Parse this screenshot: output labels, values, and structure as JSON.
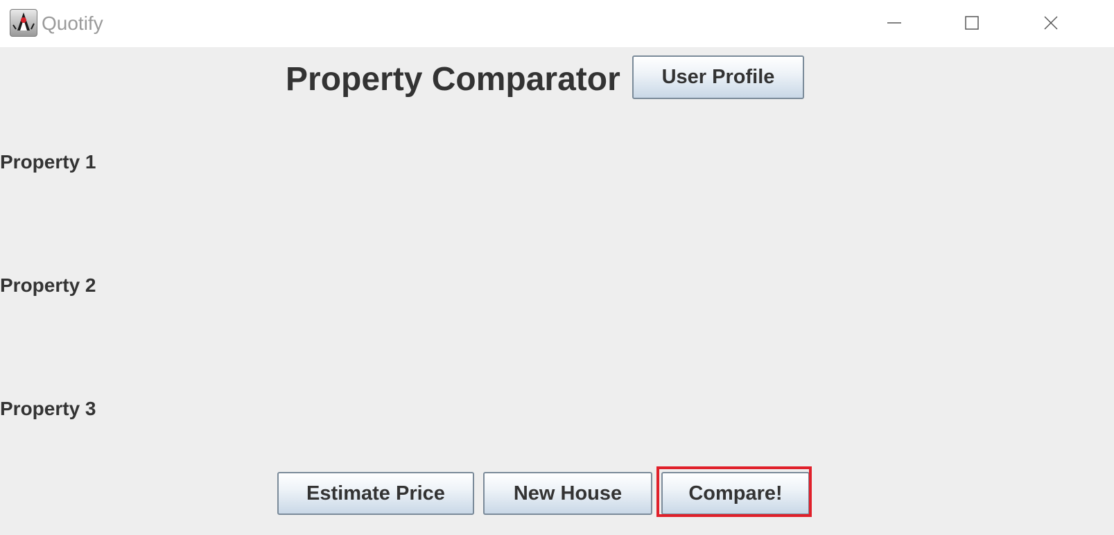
{
  "window": {
    "title": "Quotify",
    "app_icon": "java-duke-icon",
    "controls": {
      "minimize": "minimize-icon",
      "maximize": "maximize-icon",
      "close": "close-icon"
    }
  },
  "header": {
    "title": "Property Comparator",
    "user_profile_label": "User Profile"
  },
  "properties": [
    {
      "label": "Property 1"
    },
    {
      "label": "Property 2"
    },
    {
      "label": "Property 3"
    }
  ],
  "actions": {
    "estimate_label": "Estimate Price",
    "new_house_label": "New House",
    "compare_label": "Compare!"
  },
  "colors": {
    "highlight": "#e0202a",
    "background": "#eeeeee",
    "text": "#333333"
  }
}
